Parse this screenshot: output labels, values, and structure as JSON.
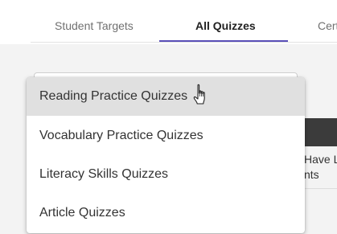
{
  "tabs": [
    {
      "label": "Student Targets",
      "active": false
    },
    {
      "label": "All Quizzes",
      "active": true
    },
    {
      "label": "Cert",
      "active": false
    }
  ],
  "accent_color": "#5a4fb8",
  "background_content": {
    "line1": "Have Le",
    "line2": "nts"
  },
  "dropdown": {
    "items": [
      {
        "label": "Reading Practice Quizzes",
        "selected": true
      },
      {
        "label": "Vocabulary Practice Quizzes",
        "selected": false
      },
      {
        "label": "Literacy Skills Quizzes",
        "selected": false
      },
      {
        "label": "Article Quizzes",
        "selected": false
      }
    ]
  },
  "cursor": {
    "icon": "hand-pointer-icon"
  }
}
